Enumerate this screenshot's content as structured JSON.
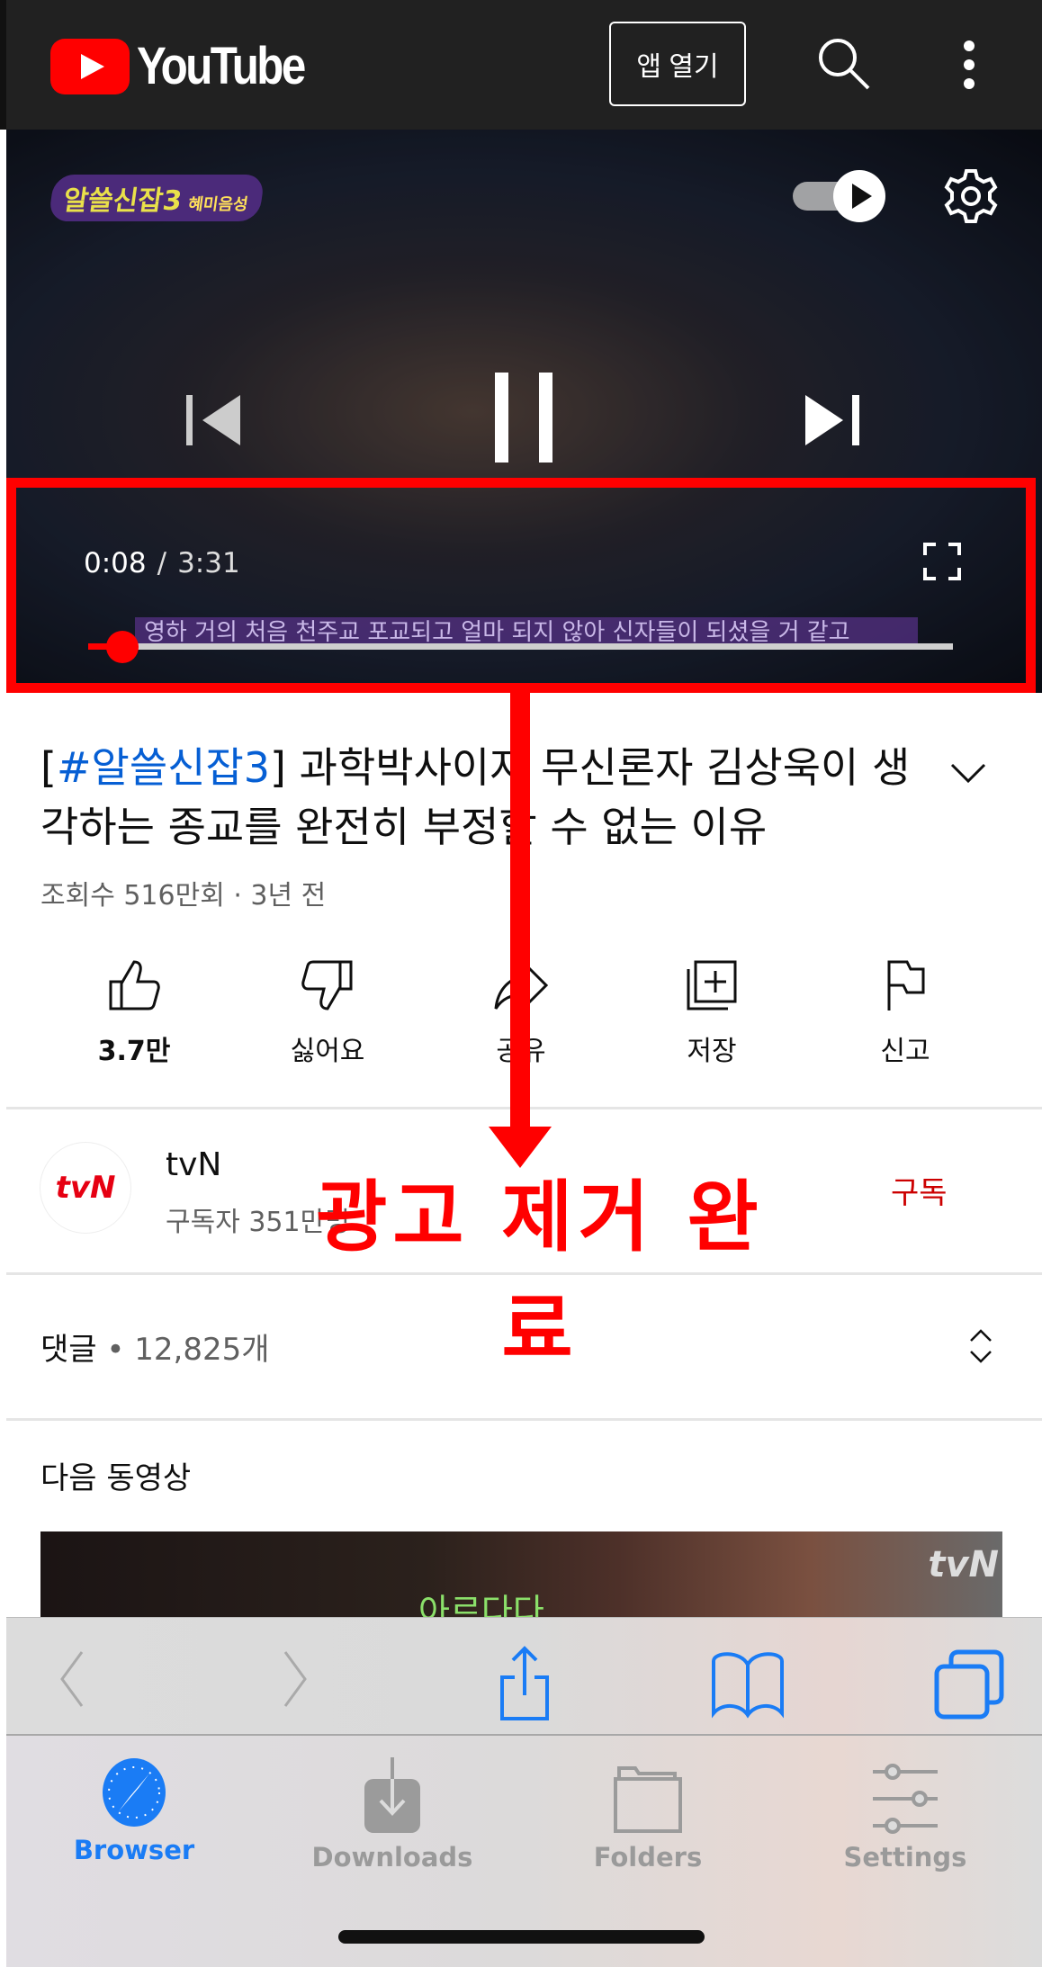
{
  "header": {
    "logo_text": "YouTube",
    "open_app_label": "앱 열기",
    "icons": [
      "search-icon",
      "more-vert-icon"
    ],
    "bg": "#212121"
  },
  "player": {
    "channel_badge": "알쓸신잡3",
    "channel_badge_sub": "혜미음성",
    "current_time": "0:08",
    "separator": "/",
    "duration": "3:31",
    "progress_fraction": 0.04,
    "subtitle": "영하   거의 처음 천주교 포교되고 얼마 되지 않아 신자들이 되셨을 거 같고",
    "icons": [
      "autoplay-toggle-icon",
      "settings-gear-icon",
      "previous-icon",
      "pause-icon",
      "next-icon",
      "fullscreen-icon"
    ],
    "accent": "#ff0000"
  },
  "video": {
    "title_tag": "#알쓸신잡3",
    "title_rest": " 과학박사이자 무신론자 김상욱이 생각하는 종교를 완전히 부정할 수 없는 이유",
    "meta": "조회수 516만회 · 3년 전"
  },
  "actions": [
    {
      "icon": "thumbs-up-icon",
      "label": "3.7만"
    },
    {
      "icon": "thumbs-down-icon",
      "label": "싫어요"
    },
    {
      "icon": "share-icon",
      "label": "공유"
    },
    {
      "icon": "save-playlist-icon",
      "label": "저장"
    },
    {
      "icon": "flag-icon",
      "label": "신고"
    }
  ],
  "channel": {
    "avatar_text": "tvN",
    "name": "tvN",
    "subscribers": "구독자 351만명",
    "subscribe_label": "구독",
    "subscribe_color": "#cc0000"
  },
  "comments": {
    "label": "댓글",
    "count": "12,825개"
  },
  "up_next": {
    "label": "다음 동영상",
    "thumb_watermark": "tvN",
    "thumb_caption": "아르다다"
  },
  "browser_toolbar": {
    "icons": [
      "back-icon",
      "forward-icon",
      "share-icon",
      "bookmarks-icon",
      "tabs-icon"
    ]
  },
  "tabbar": {
    "items": [
      {
        "label": "Browser",
        "icon": "compass-icon",
        "active": true
      },
      {
        "label": "Downloads",
        "icon": "download-icon",
        "active": false
      },
      {
        "label": "Folders",
        "icon": "folder-icon",
        "active": false
      },
      {
        "label": "Settings",
        "icon": "sliders-icon",
        "active": false
      }
    ],
    "active_color": "#1a7cf5"
  },
  "annotation": {
    "text": "광고 제거 완료",
    "color": "#ff0000"
  }
}
